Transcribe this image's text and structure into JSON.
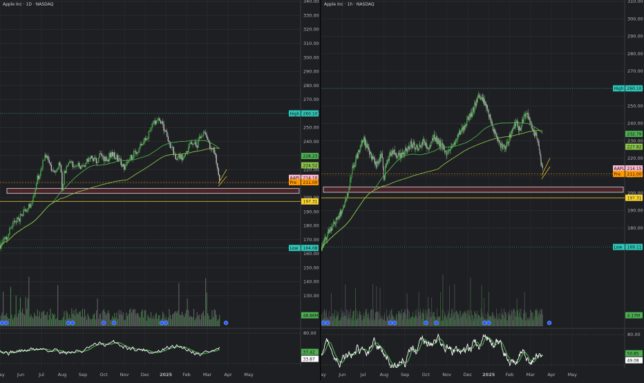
{
  "chart_data": [
    {
      "type": "candlestick",
      "title": "Apple Inc · 1D · NASDAQ",
      "price_axis": {
        "min": 120,
        "max": 340,
        "ticks": [
          "340.00",
          "330.00",
          "320.00",
          "310.00",
          "300.00",
          "290.00",
          "280.00",
          "270.00",
          "260.00",
          "250.00",
          "240.00",
          "230.00",
          "220.00",
          "210.00",
          "200.00",
          "190.00",
          "180.00",
          "170.00",
          "160.00",
          "150.00",
          "140.00",
          "130.00"
        ],
        "tick_values": [
          340,
          330,
          320,
          310,
          300,
          290,
          280,
          270,
          260,
          250,
          240,
          230,
          220,
          210,
          200,
          190,
          180,
          170,
          160,
          150,
          140,
          130
        ]
      },
      "time_axis": {
        "labels": [
          "May",
          "Jun",
          "Jul",
          "Aug",
          "Sep",
          "Oct",
          "Nov",
          "Dec",
          "2025",
          "Feb",
          "Mar",
          "Apr",
          "May"
        ],
        "label_months": [
          0,
          1,
          2,
          3,
          4,
          5,
          6,
          7,
          8,
          9,
          10,
          11,
          12
        ]
      },
      "close_path": [
        [
          0,
          166
        ],
        [
          0.3,
          170
        ],
        [
          0.6,
          181
        ],
        [
          0.9,
          185
        ],
        [
          1.2,
          190
        ],
        [
          1.5,
          196
        ],
        [
          1.8,
          213
        ],
        [
          2.0,
          220
        ],
        [
          2.2,
          232
        ],
        [
          2.4,
          222
        ],
        [
          2.7,
          218
        ],
        [
          2.9,
          225
        ],
        [
          3.0,
          205
        ],
        [
          3.1,
          218
        ],
        [
          3.4,
          225
        ],
        [
          3.7,
          222
        ],
        [
          4.0,
          223
        ],
        [
          4.3,
          228
        ],
        [
          4.6,
          226
        ],
        [
          4.9,
          231
        ],
        [
          5.1,
          226
        ],
        [
          5.4,
          232
        ],
        [
          5.7,
          228
        ],
        [
          6.0,
          222
        ],
        [
          6.3,
          228
        ],
        [
          6.6,
          234
        ],
        [
          6.9,
          238
        ],
        [
          7.2,
          246
        ],
        [
          7.5,
          255
        ],
        [
          7.7,
          254
        ],
        [
          7.9,
          250
        ],
        [
          8.1,
          242
        ],
        [
          8.3,
          235
        ],
        [
          8.5,
          228
        ],
        [
          8.7,
          230
        ],
        [
          8.9,
          228
        ],
        [
          9.0,
          233
        ],
        [
          9.3,
          240
        ],
        [
          9.5,
          236
        ],
        [
          9.7,
          245
        ],
        [
          9.9,
          244
        ],
        [
          10.1,
          238
        ],
        [
          10.3,
          235
        ],
        [
          10.5,
          220
        ],
        [
          10.6,
          214
        ]
      ],
      "markers": {
        "high": {
          "label": "High",
          "value_label": "260.10",
          "value": 260.1,
          "color": "#26a69a"
        },
        "low": {
          "label": "Low",
          "value_label": "164.08",
          "value": 164.08,
          "color": "#26a69a"
        },
        "ma_fast": {
          "value_label": "228.23",
          "value": 228.23,
          "color": "#4caf50"
        },
        "ma_slow": {
          "value_label": "224.52",
          "value": 224.52,
          "color": "#8bc34a"
        },
        "last": {
          "label": "AAPL",
          "value_label": "214.10",
          "value": 214.1,
          "color": "#f8bbd0"
        },
        "pre": {
          "label": "Pre",
          "value_label": "211.00",
          "value": 211,
          "color": "#ff9800"
        },
        "support": {
          "value_label": "197.31",
          "value": 197.31,
          "color": "#fdd835"
        }
      },
      "zone": {
        "from": 203,
        "to": 206.5,
        "color": "#4a2428"
      },
      "volume_label": "48.86M",
      "rsi": {
        "ticks": [
          "80.00"
        ],
        "value_labels": [
          "37.42",
          "33.87"
        ]
      }
    },
    {
      "type": "candlestick",
      "title": "Apple Inc · 1h · NASDAQ",
      "price_axis": {
        "min": 120,
        "max": 310,
        "ticks": [
          "310.00",
          "300.00",
          "290.00",
          "280.00",
          "270.00",
          "260.00",
          "250.00",
          "240.00",
          "230.00",
          "220.00",
          "210.00",
          "200.00",
          "190.00",
          "180.00"
        ],
        "tick_values": [
          310,
          300,
          290,
          280,
          270,
          260,
          250,
          240,
          230,
          220,
          210,
          200,
          190,
          180
        ]
      },
      "time_axis": {
        "labels": [
          "May",
          "Jun",
          "Jul",
          "Aug",
          "Sep",
          "Oct",
          "Nov",
          "Dec",
          "2025",
          "Feb",
          "Mar",
          "Apr",
          "May"
        ],
        "label_months": [
          0,
          1,
          2,
          3,
          4,
          5,
          6,
          7,
          8,
          9,
          10,
          11,
          12
        ]
      },
      "close_path": [
        [
          0,
          169
        ],
        [
          0.3,
          176
        ],
        [
          0.6,
          182
        ],
        [
          0.9,
          188
        ],
        [
          1.2,
          196
        ],
        [
          1.5,
          214
        ],
        [
          1.8,
          224
        ],
        [
          2.0,
          232
        ],
        [
          2.2,
          226
        ],
        [
          2.4,
          220
        ],
        [
          2.7,
          216
        ],
        [
          2.9,
          224
        ],
        [
          3.0,
          207
        ],
        [
          3.1,
          218
        ],
        [
          3.4,
          224
        ],
        [
          3.7,
          221
        ],
        [
          4.0,
          224
        ],
        [
          4.3,
          228
        ],
        [
          4.6,
          226
        ],
        [
          4.9,
          230
        ],
        [
          5.1,
          226
        ],
        [
          5.4,
          232
        ],
        [
          5.7,
          228
        ],
        [
          6.0,
          222
        ],
        [
          6.3,
          228
        ],
        [
          6.6,
          234
        ],
        [
          6.9,
          240
        ],
        [
          7.2,
          246
        ],
        [
          7.5,
          255
        ],
        [
          7.7,
          254
        ],
        [
          7.9,
          250
        ],
        [
          8.1,
          242
        ],
        [
          8.3,
          234
        ],
        [
          8.5,
          228
        ],
        [
          8.7,
          226
        ],
        [
          8.9,
          228
        ],
        [
          9.0,
          233
        ],
        [
          9.3,
          240
        ],
        [
          9.5,
          236
        ],
        [
          9.7,
          245
        ],
        [
          9.9,
          244
        ],
        [
          10.1,
          236
        ],
        [
          10.3,
          232
        ],
        [
          10.5,
          218
        ],
        [
          10.6,
          212
        ]
      ],
      "markers": {
        "high": {
          "label": "High",
          "value_label": "260.10",
          "value": 260.1,
          "color": "#26a69a"
        },
        "low": {
          "label": "Low",
          "value_label": "169.11",
          "value": 169.11,
          "color": "#26a69a"
        },
        "ma_fast": {
          "value_label": "232.79",
          "value": 232.79,
          "color": "#4caf50"
        },
        "ma_slow": {
          "value_label": "227.82",
          "value": 227.82,
          "color": "#8bc34a"
        },
        "last": {
          "label": "AAPL",
          "value_label": "214.15",
          "value": 214.15,
          "color": "#f8bbd0"
        },
        "pre": {
          "label": "Pre",
          "value_label": "211.00",
          "value": 211,
          "color": "#ff9800"
        },
        "support": {
          "value_label": "197.31",
          "value": 197.31,
          "color": "#fdd835"
        }
      },
      "zone": {
        "from": 200.5,
        "to": 203.5,
        "color": "#4a2428"
      },
      "volume_label": "4.17M",
      "rsi": {
        "ticks": [
          "80.00"
        ],
        "value_labels": [
          "50.85",
          "49.08"
        ]
      }
    }
  ]
}
